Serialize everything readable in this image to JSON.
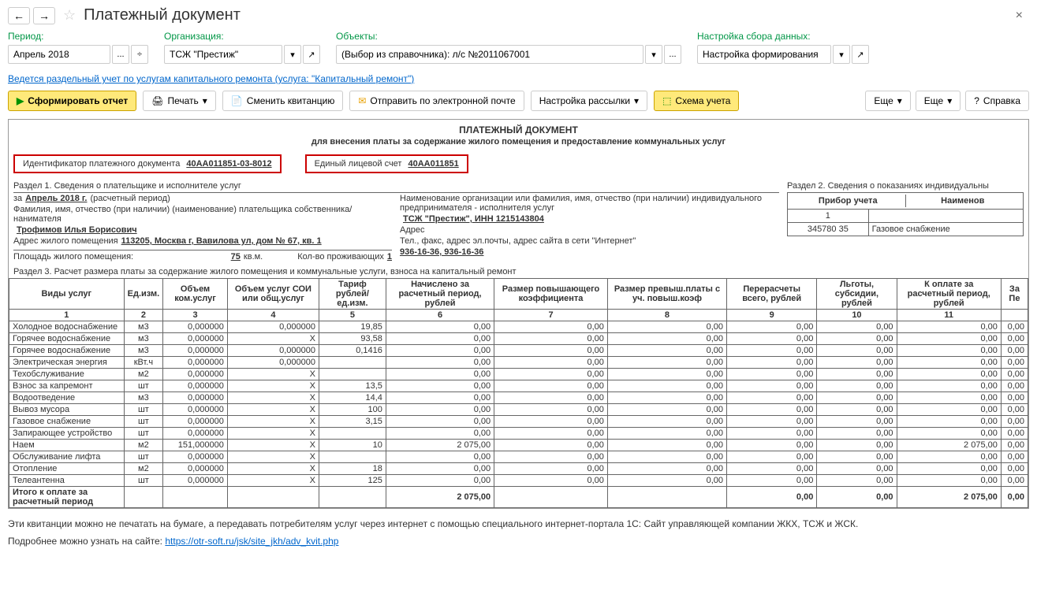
{
  "title": "Платежный документ",
  "filters": {
    "period_label": "Период:",
    "period_value": "Апрель 2018",
    "org_label": "Организация:",
    "org_value": "ТСЖ \"Престиж\"",
    "objects_label": "Объекты:",
    "objects_value": "(Выбор из справочника): л/с №2011067001",
    "settings_label": "Настройка сбора данных:",
    "settings_value": "Настройка формирования"
  },
  "cap_link": "Ведется раздельный учет по услугам капитального ремонта (услуга: \"Капитальный ремонт\")",
  "toolbar": {
    "generate": "Сформировать отчет",
    "print": "Печать",
    "change": "Сменить квитанцию",
    "send": "Отправить по электронной почте",
    "mailing": "Настройка рассылки",
    "scheme": "Схема учета",
    "more": "Еще",
    "help": "Справка"
  },
  "doc": {
    "header": "ПЛАТЕЖНЫЙ ДОКУМЕНТ",
    "subheader": "для внесения платы за содержание жилого помещения и предоставление коммунальных услуг",
    "id_label": "Идентификатор платежного документа",
    "id_value": "40АА011851-03-8012",
    "account_label": "Единый лицевой счет",
    "account_value": "40АА011851",
    "section1_title": "Раздел 1.    Сведения о плательщике и исполнителе услуг",
    "period_row_pre": "за",
    "period_row_val": "Апрель 2018 г.",
    "period_row_post": "(расчетный период)",
    "fio_label": "Фамилия, имя, отчество (при наличии) (наименование) плательщика собственника/нанимателя",
    "fio_value": "Трофимов Илья Борисович",
    "addr_label": "Адрес жилого помещения",
    "addr_value": "113205, Москва г, Вавилова ул, дом № 67, кв. 1",
    "org_label": "Наименование организации или фамилия, имя, отчество (при наличии) индивидуального предпринимателя - исполнителя услуг",
    "org_value": "ТСЖ \"Престиж\", ИНН 1215143804",
    "org_addr_label": "Адрес",
    "org_tel_label": "Тел., факс, адрес эл.почты, адрес сайта в сети \"Интернет\"",
    "org_tel_value": "936-16-36, 936-16-36",
    "area_label": "Площадь жилого помещения:",
    "area_value": "75",
    "area_unit": "кв.м.",
    "residents_label": "Кол-во проживающих",
    "residents_value": "1",
    "section2_title": "Раздел 2.    Сведения о показаниях индивидуальны",
    "section2_h1": "Прибор учета",
    "section2_h2": "Наименов",
    "section2_num": "1",
    "section2_v1": "345780 35",
    "section2_v2": "Газовое снабжение",
    "section3_title": "Раздел 3.    Расчет размера платы за содержание жилого помещения и коммунальные услуги, взноса на капитальный ремонт"
  },
  "cols": [
    "Виды услуг",
    "Ед.изм.",
    "Объем ком.услуг",
    "Объем услуг СОИ или общ.услуг",
    "Тариф рублей/ ед.изм.",
    "Начислено за расчетный период, рублей",
    "Размер повышающего коэффициента",
    "Размер превыш.платы с уч. повыш.коэф",
    "Перерасчеты всего, рублей",
    "Льготы, субсидии, рублей",
    "К оплате за расчетный период, рублей",
    "За Пе"
  ],
  "colnums": [
    "1",
    "2",
    "3",
    "4",
    "5",
    "6",
    "7",
    "8",
    "9",
    "10",
    "11",
    ""
  ],
  "rows": [
    {
      "name": "Холодное водоснабжение",
      "u": "м3",
      "v": [
        "0,000000",
        "0,000000",
        "19,85",
        "0,00",
        "0,00",
        "0,00",
        "0,00",
        "0,00",
        "0,00",
        "0,00"
      ]
    },
    {
      "name": "Горячее водоснабжение",
      "u": "м3",
      "v": [
        "0,000000",
        "Х",
        "93,58",
        "0,00",
        "0,00",
        "0,00",
        "0,00",
        "0,00",
        "0,00",
        "0,00"
      ]
    },
    {
      "name": "Горячее водоснабжение",
      "u": "м3",
      "v": [
        "0,000000",
        "0,000000",
        "0,1416",
        "0,00",
        "0,00",
        "0,00",
        "0,00",
        "0,00",
        "0,00",
        "0,00"
      ]
    },
    {
      "name": "Электрическая энергия",
      "u": "кВт.ч",
      "v": [
        "0,000000",
        "0,000000",
        "",
        "0,00",
        "0,00",
        "0,00",
        "0,00",
        "0,00",
        "0,00",
        "0,00"
      ]
    },
    {
      "name": "Техобслуживание",
      "u": "м2",
      "v": [
        "0,000000",
        "Х",
        "",
        "0,00",
        "0,00",
        "0,00",
        "0,00",
        "0,00",
        "0,00",
        "0,00"
      ]
    },
    {
      "name": "Взнос за капремонт",
      "u": "шт",
      "v": [
        "0,000000",
        "Х",
        "13,5",
        "0,00",
        "0,00",
        "0,00",
        "0,00",
        "0,00",
        "0,00",
        "0,00"
      ]
    },
    {
      "name": "Водоотведение",
      "u": "м3",
      "v": [
        "0,000000",
        "Х",
        "14,4",
        "0,00",
        "0,00",
        "0,00",
        "0,00",
        "0,00",
        "0,00",
        "0,00"
      ]
    },
    {
      "name": "Вывоз мусора",
      "u": "шт",
      "v": [
        "0,000000",
        "Х",
        "100",
        "0,00",
        "0,00",
        "0,00",
        "0,00",
        "0,00",
        "0,00",
        "0,00"
      ]
    },
    {
      "name": "Газовое снабжение",
      "u": "шт",
      "v": [
        "0,000000",
        "Х",
        "3,15",
        "0,00",
        "0,00",
        "0,00",
        "0,00",
        "0,00",
        "0,00",
        "0,00"
      ]
    },
    {
      "name": "Запирающее устройство",
      "u": "шт",
      "v": [
        "0,000000",
        "Х",
        "",
        "0,00",
        "0,00",
        "0,00",
        "0,00",
        "0,00",
        "0,00",
        "0,00"
      ]
    },
    {
      "name": "Наем",
      "u": "м2",
      "v": [
        "151,000000",
        "Х",
        "10",
        "2 075,00",
        "0,00",
        "0,00",
        "0,00",
        "0,00",
        "2 075,00",
        "0,00"
      ]
    },
    {
      "name": "Обслуживание лифта",
      "u": "шт",
      "v": [
        "0,000000",
        "Х",
        "",
        "0,00",
        "0,00",
        "0,00",
        "0,00",
        "0,00",
        "0,00",
        "0,00"
      ]
    },
    {
      "name": "Отопление",
      "u": "м2",
      "v": [
        "0,000000",
        "Х",
        "18",
        "0,00",
        "0,00",
        "0,00",
        "0,00",
        "0,00",
        "0,00",
        "0,00"
      ]
    },
    {
      "name": "Телеантенна",
      "u": "шт",
      "v": [
        "0,000000",
        "Х",
        "125",
        "0,00",
        "0,00",
        "0,00",
        "0,00",
        "0,00",
        "0,00",
        "0,00"
      ]
    }
  ],
  "totals": {
    "name": "Итого к оплате за расчетный период",
    "v": [
      "",
      "",
      "",
      "",
      "2 075,00",
      "",
      "",
      "0,00",
      "0,00",
      "2 075,00",
      "0,00"
    ]
  },
  "footnote": "Эти квитанции можно не печатать на бумаге, а передавать потребителям услуг через интернет с помощью специального интернет-портала 1С: Сайт управляющей компании ЖКХ, ТСЖ и ЖСК.",
  "footnote_link_pre": "Подробнее можно узнать на сайте: ",
  "footnote_link": "https://otr-soft.ru/jsk/site_jkh/adv_kvit.php"
}
